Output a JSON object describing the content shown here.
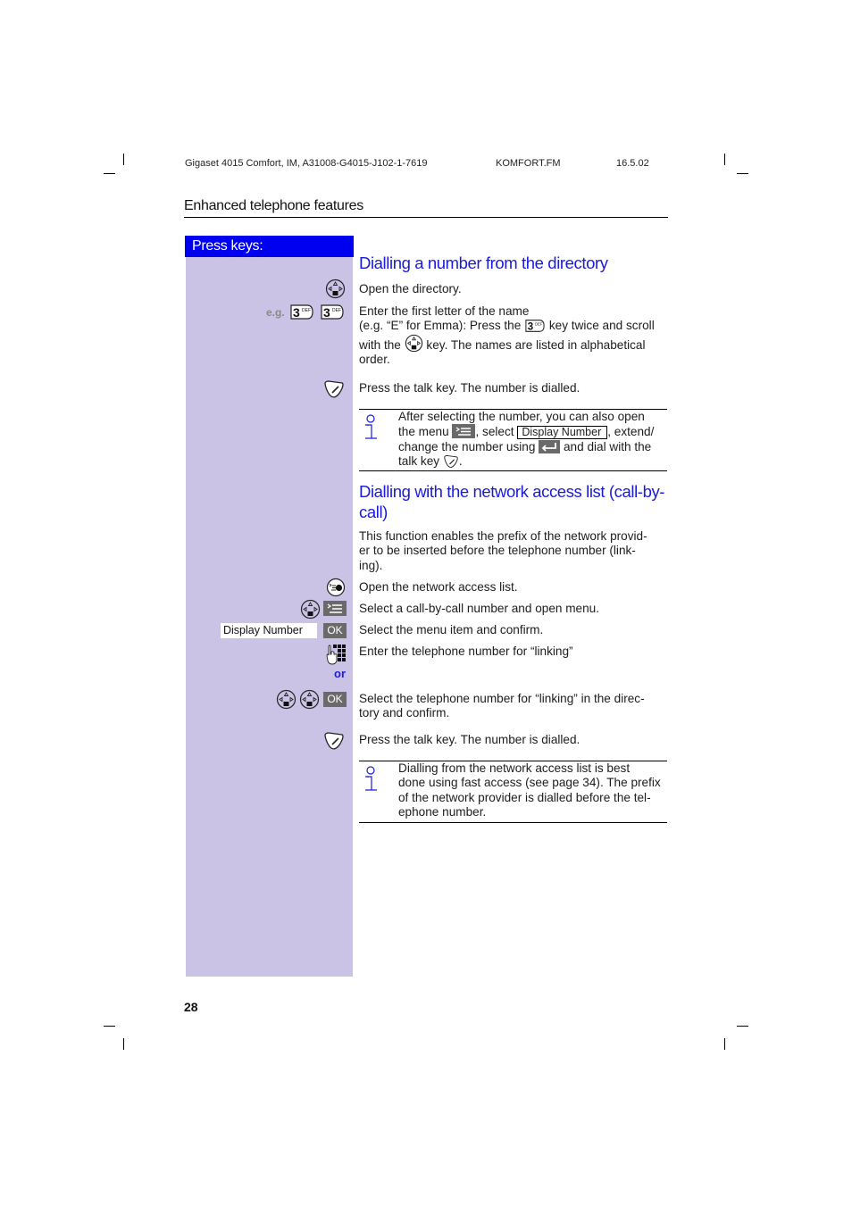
{
  "header": {
    "doc_id": "Gigaset 4015 Comfort, IM, A31008-G4015-J102-1-7619",
    "file": "KOMFORT.FM",
    "date": "16.5.02"
  },
  "section_title": "Enhanced telephone features",
  "sidebar": {
    "title": "Press keys:",
    "eg_label": "e.g.",
    "key_3_label": "3",
    "key_3_sub": "DEF",
    "display_number_field": "Display Number",
    "ok_label": "OK",
    "or_label": "or"
  },
  "section1": {
    "heading": "Dialling a number from the directory",
    "steps": [
      {
        "icon": "nav-key-icon",
        "text": "Open the directory."
      },
      {
        "icon": "key-3-icon",
        "text_a": "Enter the first letter of the name",
        "text_b": "(e.g. “E” for Emma): Press the",
        "text_c": "key twice and scroll",
        "text_d": "with the",
        "text_e": "key. The names are listed in alphabetical",
        "text_f": "order."
      },
      {
        "icon": "talk-key-icon",
        "text": "Press the talk key. The number is dialled."
      }
    ],
    "note": {
      "line1": "After selecting the number, you can also open",
      "line2a": "the menu",
      "line2b": ", select",
      "display_number": "Display Number",
      "line2c": ", extend/",
      "line3a": "change the number using",
      "line3b": "and dial with the",
      "line4a": "talk key",
      "line4b": "."
    }
  },
  "section2": {
    "heading_line1": "Dialling with the network access list (call-by-",
    "heading_line2": "call)",
    "intro": [
      "This function enables the prefix of the network provid-",
      "er to be inserted before the telephone number (link-",
      "ing)."
    ],
    "steps": [
      {
        "icon": "network-access-key-icon",
        "text": "Open the network access list."
      },
      {
        "icon": "nav-key-menu-icon",
        "text": "Select a call-by-call number and open menu."
      },
      {
        "icon": "display-number-ok",
        "text": "Select the menu item and confirm."
      },
      {
        "icon": "keypad-icon",
        "text": "Enter the telephone number for “linking”"
      },
      {
        "icon": "nav-nav-ok-icon",
        "text_line1": "Select the telephone number for “linking” in the direc-",
        "text_line2": "tory and confirm."
      },
      {
        "icon": "talk-key-icon",
        "text": "Press the talk key. The number is dialled."
      }
    ],
    "note": [
      "Dialling from the network access list is best",
      "done using fast access (see page 34). The prefix",
      "of the network provider is dialled before the tel-",
      "ephone number."
    ]
  },
  "page_number": "28",
  "colors": {
    "accent_blue": "#0000f0",
    "heading_blue": "#1a1adc",
    "sidebar_lavender": "#cbc3e5",
    "softkey_gray": "#6a6a6a"
  }
}
